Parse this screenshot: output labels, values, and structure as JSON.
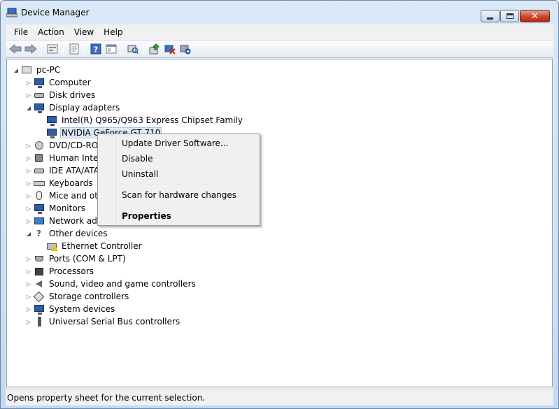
{
  "window": {
    "title": "Device Manager"
  },
  "caption": {
    "minimize": "minimize",
    "maximize": "maximize",
    "close": "✕"
  },
  "menu": [
    "File",
    "Action",
    "View",
    "Help"
  ],
  "toolbar": {
    "icons": [
      "back-icon",
      "forward-icon",
      "up-tree-icon",
      "properties-sheet-icon",
      "help-icon",
      "show-hide-console-tree-icon",
      "scan-hardware-icon",
      "update-driver-icon",
      "disable-device-icon",
      "uninstall-device-icon"
    ]
  },
  "tree": {
    "root": "pc-PC",
    "nodes": [
      {
        "label": "Computer",
        "expanded": false,
        "icon": "computer-icon"
      },
      {
        "label": "Disk drives",
        "expanded": false,
        "icon": "disk-drive-icon"
      },
      {
        "label": "Display adapters",
        "expanded": true,
        "icon": "display-adapter-icon",
        "children": [
          {
            "label": "Intel(R)  Q965/Q963 Express Chipset Family",
            "icon": "display-adapter-icon"
          },
          {
            "label": "NVIDIA GeForce GT 710",
            "icon": "display-adapter-icon",
            "selected": true
          }
        ]
      },
      {
        "label": "DVD/CD-ROM",
        "expanded": false,
        "icon": "dvd-drive-icon"
      },
      {
        "label": "Human Inter",
        "expanded": false,
        "icon": "hid-icon"
      },
      {
        "label": "IDE ATA/ATA",
        "expanded": false,
        "icon": "ide-controller-icon"
      },
      {
        "label": "Keyboards",
        "expanded": false,
        "icon": "keyboard-icon"
      },
      {
        "label": "Mice and oth",
        "expanded": false,
        "icon": "mouse-icon"
      },
      {
        "label": "Monitors",
        "expanded": false,
        "icon": "monitor-icon"
      },
      {
        "label": "Network ada",
        "expanded": false,
        "icon": "network-adapter-icon"
      },
      {
        "label": "Other devices",
        "expanded": true,
        "icon": "other-devices-icon",
        "children": [
          {
            "label": "Ethernet Controller",
            "icon": "warning-device-icon"
          }
        ]
      },
      {
        "label": "Ports (COM & LPT)",
        "expanded": false,
        "icon": "port-icon"
      },
      {
        "label": "Processors",
        "expanded": false,
        "icon": "processor-icon"
      },
      {
        "label": "Sound, video and game controllers",
        "expanded": false,
        "icon": "sound-icon"
      },
      {
        "label": "Storage controllers",
        "expanded": false,
        "icon": "storage-controller-icon"
      },
      {
        "label": "System devices",
        "expanded": false,
        "icon": "system-devices-icon"
      },
      {
        "label": "Universal Serial Bus controllers",
        "expanded": false,
        "icon": "usb-icon"
      }
    ]
  },
  "context_menu": {
    "items": [
      {
        "label": "Update Driver Software...",
        "bold": false
      },
      {
        "label": "Disable",
        "bold": false
      },
      {
        "label": "Uninstall",
        "bold": false
      },
      {
        "label": "Scan for hardware changes",
        "bold": false
      },
      {
        "label": "Properties",
        "bold": true
      }
    ]
  },
  "status": {
    "text": "Opens property sheet for the current selection."
  }
}
